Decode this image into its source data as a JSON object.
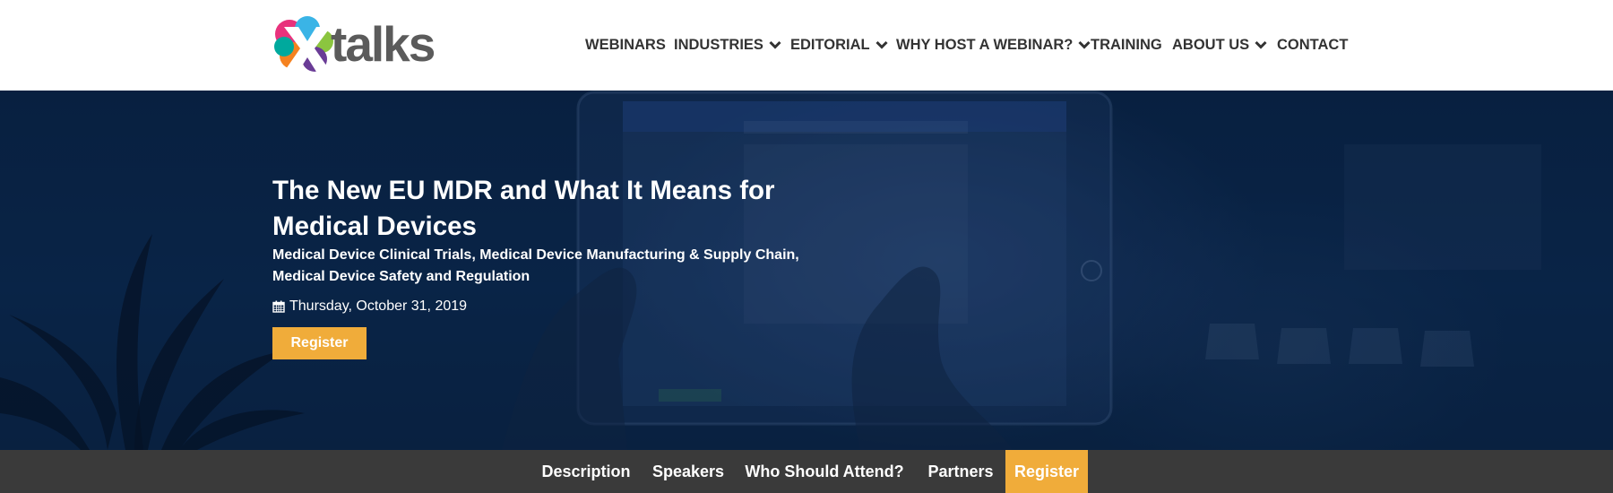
{
  "brand": {
    "logo_text": "talks",
    "logo_mark": "X"
  },
  "nav": {
    "items": [
      {
        "label": "WEBINARS",
        "dropdown": false
      },
      {
        "label": "INDUSTRIES",
        "dropdown": true
      },
      {
        "label": "EDITORIAL",
        "dropdown": true
      },
      {
        "label": "WHY HOST A WEBINAR?",
        "dropdown": true
      },
      {
        "label": "TRAINING",
        "dropdown": false
      },
      {
        "label": "ABOUT US",
        "dropdown": true
      },
      {
        "label": "CONTACT",
        "dropdown": false
      }
    ]
  },
  "hero": {
    "title_line1": "The New EU MDR and What It Means for",
    "title_line2": "Medical Devices",
    "categories_line1": "Medical Device Clinical Trials, Medical Device Manufacturing & Supply Chain,",
    "categories_line2": "Medical Device Safety and Regulation",
    "date": "Thursday, October 31, 2019",
    "register_label": "Register"
  },
  "subnav": {
    "items": [
      {
        "label": "Description"
      },
      {
        "label": "Speakers"
      },
      {
        "label": "Who Should Attend?"
      },
      {
        "label": "Partners"
      },
      {
        "label": "Register"
      }
    ]
  },
  "colors": {
    "accent": "#f0ac3a",
    "hero_bg": "#0c2a50",
    "subnav_bg": "#3a3a3a",
    "nav_text": "#333333"
  }
}
